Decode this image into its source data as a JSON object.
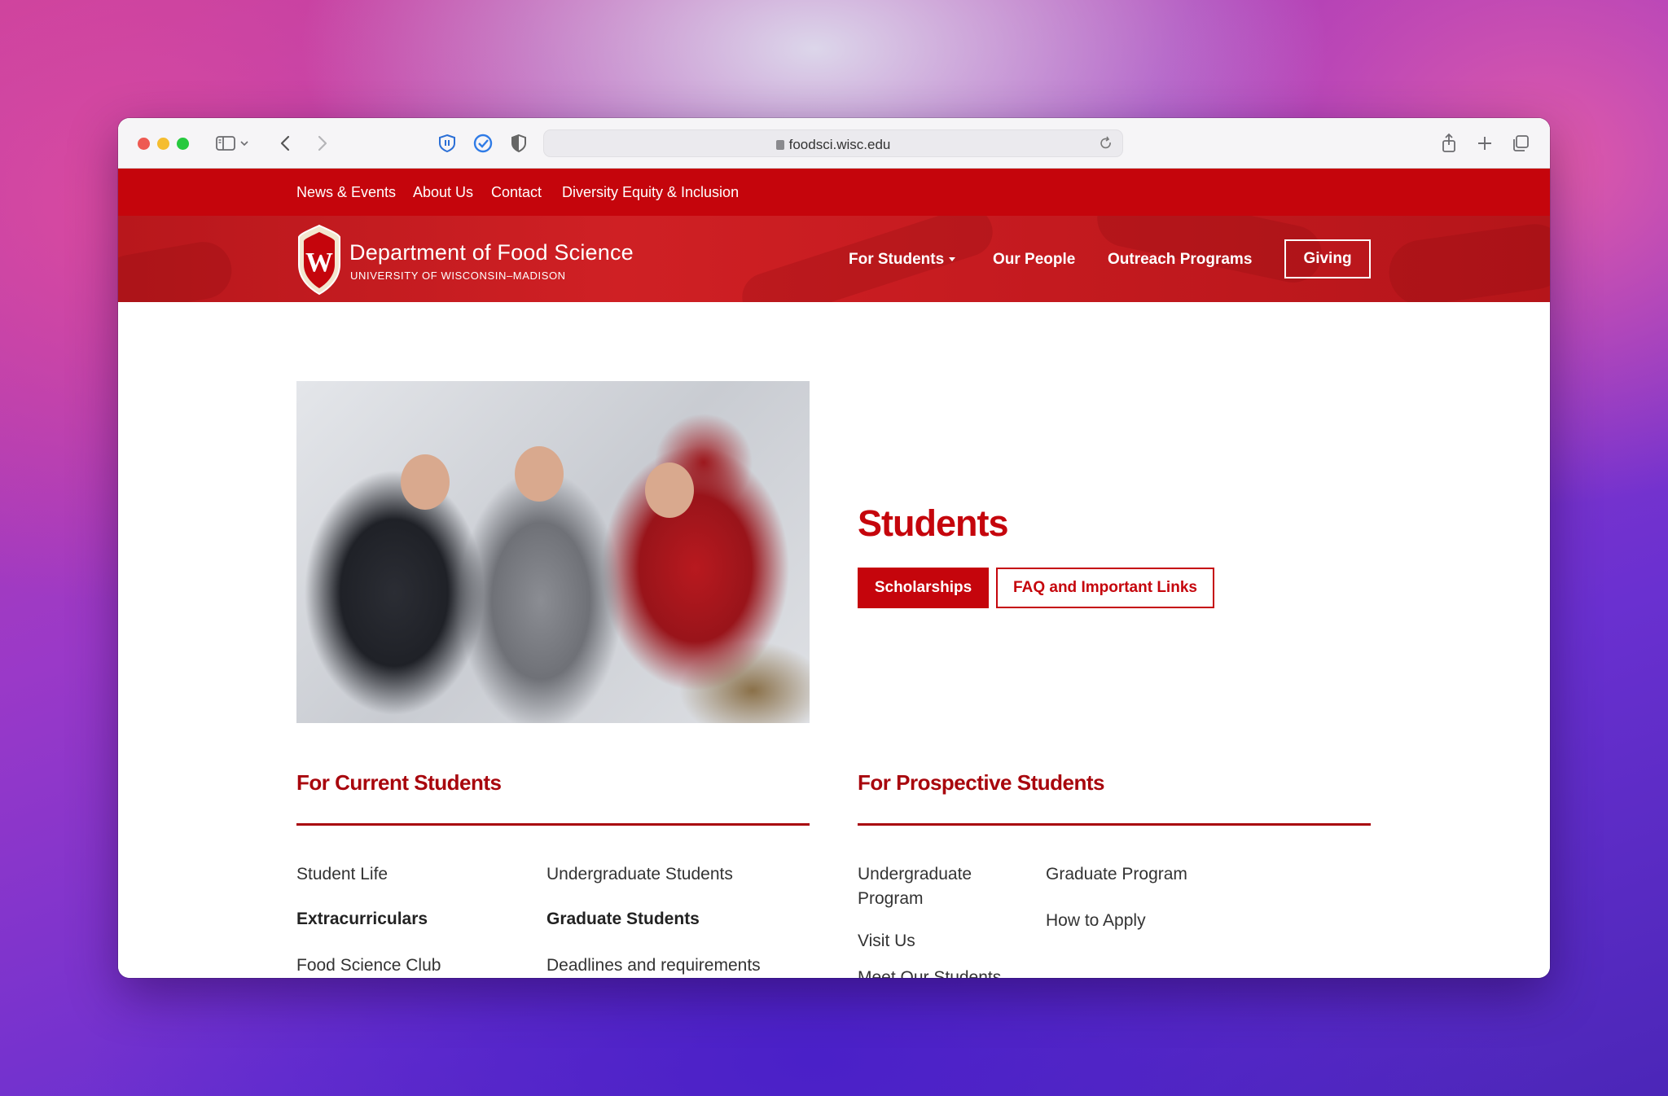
{
  "browser": {
    "url": "foodsci.wisc.edu"
  },
  "utility_nav": [
    "News & Events",
    "About Us",
    "Contact",
    "Diversity Equity & Inclusion"
  ],
  "site": {
    "title": "Department of Food Science",
    "subtitle": "UNIVERSITY OF WISCONSIN–MADISON",
    "crest_letter": "W"
  },
  "main_nav": {
    "for_students": "For Students",
    "our_people": "Our People",
    "outreach": "Outreach Programs",
    "giving": "Giving"
  },
  "page": {
    "title": "Students",
    "btn_scholarships": "Scholarships",
    "btn_faq": "FAQ and Important Links"
  },
  "current": {
    "heading": "For Current Students",
    "col1": [
      "Student Life",
      "Extracurriculars",
      "Food Science Club"
    ],
    "col2": [
      "Undergraduate Students",
      "Graduate Students",
      "Deadlines and requirements"
    ]
  },
  "prospective": {
    "heading": "For Prospective Students",
    "col1": [
      "Undergraduate Program",
      "Visit Us",
      "Meet Our Students"
    ],
    "col2": [
      "Graduate Program",
      "How to Apply"
    ]
  },
  "colors": {
    "brand_red": "#c5050c",
    "heading_red": "#a8060d"
  }
}
